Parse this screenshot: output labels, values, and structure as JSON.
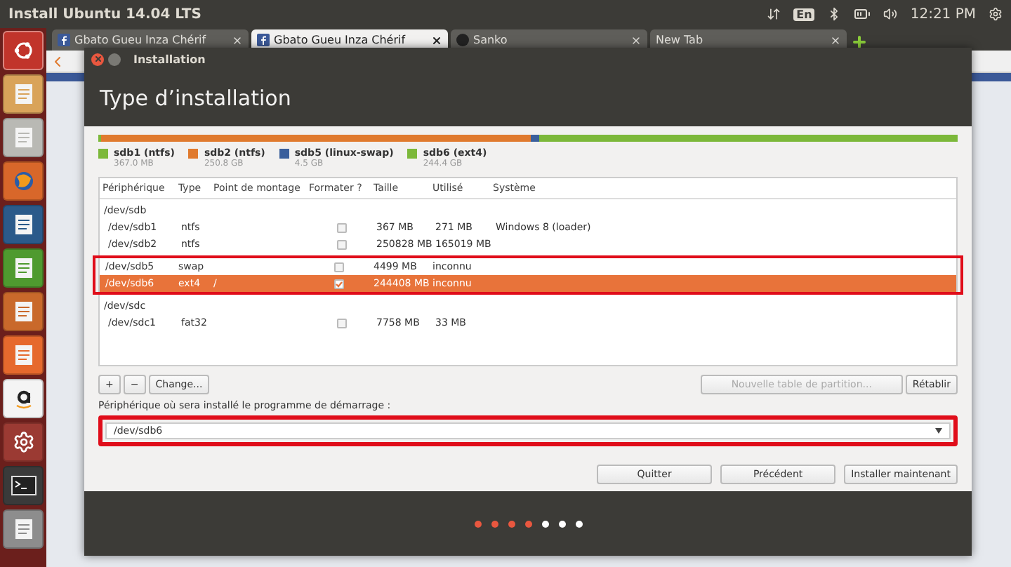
{
  "top_bar": {
    "title": "Install Ubuntu 14.04 LTS",
    "keyboard": "En",
    "time": "12:21 PM"
  },
  "launcher": {
    "items": [
      {
        "kind": "ubuntu",
        "selected": true
      },
      {
        "kind": "photos",
        "selected": false
      },
      {
        "kind": "files",
        "selected": false
      },
      {
        "kind": "browser",
        "selected": false
      },
      {
        "kind": "writer",
        "selected": false
      },
      {
        "kind": "calc",
        "selected": false
      },
      {
        "kind": "impress",
        "selected": false
      },
      {
        "kind": "store",
        "selected": false
      },
      {
        "kind": "amazon",
        "selected": false
      },
      {
        "kind": "settings",
        "selected": false
      },
      {
        "kind": "terminal",
        "selected": false
      },
      {
        "kind": "drives",
        "selected": false
      }
    ]
  },
  "browser_tabs": [
    {
      "label": "Gbato Gueu Inza Chérif",
      "kind": "facebook",
      "selected": false
    },
    {
      "label": "Gbato Gueu Inza Chérif",
      "kind": "facebook",
      "selected": true
    },
    {
      "label": "Sanko",
      "kind": "circle",
      "selected": false
    },
    {
      "label": "New Tab",
      "kind": "blank",
      "selected": false
    }
  ],
  "dialog": {
    "window_title": "Installation",
    "heading": "Type d’installation",
    "partitions": [
      {
        "name": "sdb1 (ntfs)",
        "size": "367.0 MB",
        "color": "#7cb83a",
        "level": 0.004
      },
      {
        "name": "sdb2 (ntfs)",
        "size": "250.8 GB",
        "color": "#e07a2e",
        "level": 0.5
      },
      {
        "name": "sdb5 (linux-swap)",
        "size": "4.5 GB",
        "color": "#3a5f9c",
        "level": 0.009
      },
      {
        "name": "sdb6 (ext4)",
        "size": "244.4 GB",
        "color": "#7cb83a",
        "level": 0.487
      }
    ],
    "table": {
      "columns": [
        "Périphérique",
        "Type",
        "Point de montage",
        "Formater ?",
        "Taille",
        "Utilisé",
        "Système"
      ],
      "rows": [
        {
          "kind": "device",
          "device": "/dev/sdb",
          "selected": false,
          "annotated": false
        },
        {
          "kind": "partition",
          "device": "/dev/sdb1",
          "type": "ntfs",
          "mount": "",
          "format": false,
          "size": "367 MB",
          "used": "271 MB",
          "system": "Windows 8 (loader)",
          "selected": false,
          "annotated": false
        },
        {
          "kind": "partition",
          "device": "/dev/sdb2",
          "type": "ntfs",
          "mount": "",
          "format": false,
          "size": "250828 MB",
          "used": "165019 MB",
          "system": "",
          "selected": false,
          "annotated": false
        },
        {
          "kind": "partition",
          "device": "/dev/sdb5",
          "type": "swap",
          "mount": "",
          "format": false,
          "size": "4499 MB",
          "used": "inconnu",
          "system": "",
          "selected": false,
          "annotated": true
        },
        {
          "kind": "partition",
          "device": "/dev/sdb6",
          "type": "ext4",
          "mount": "/",
          "format": true,
          "size": "244408 MB",
          "used": "inconnu",
          "system": "",
          "selected": true,
          "annotated": true
        },
        {
          "kind": "device",
          "device": "/dev/sdc",
          "selected": false,
          "annotated": false
        },
        {
          "kind": "partition",
          "device": "/dev/sdc1",
          "type": "fat32",
          "mount": "",
          "format": false,
          "size": "7758 MB",
          "used": "33 MB",
          "system": "",
          "selected": false,
          "annotated": false
        }
      ]
    },
    "table_buttons": [
      {
        "label": "+",
        "disabled": false
      },
      {
        "label": "−",
        "disabled": false
      },
      {
        "label": "Change...",
        "disabled": false
      }
    ],
    "new_table_button": {
      "label": "Nouvelle table de partition...",
      "disabled": true
    },
    "reset_button": {
      "label": "Rétablir",
      "disabled": false
    },
    "bootloader_label": "Périphérique où sera installé le programme de démarrage :",
    "bootloader_value": "/dev/sdb6",
    "buttons": [
      "Quitter",
      "Précédent",
      "Installer maintenant"
    ],
    "steps": [
      {
        "done": true
      },
      {
        "done": true
      },
      {
        "done": true
      },
      {
        "done": true
      },
      {
        "done": false
      },
      {
        "done": false
      },
      {
        "done": false
      }
    ]
  }
}
